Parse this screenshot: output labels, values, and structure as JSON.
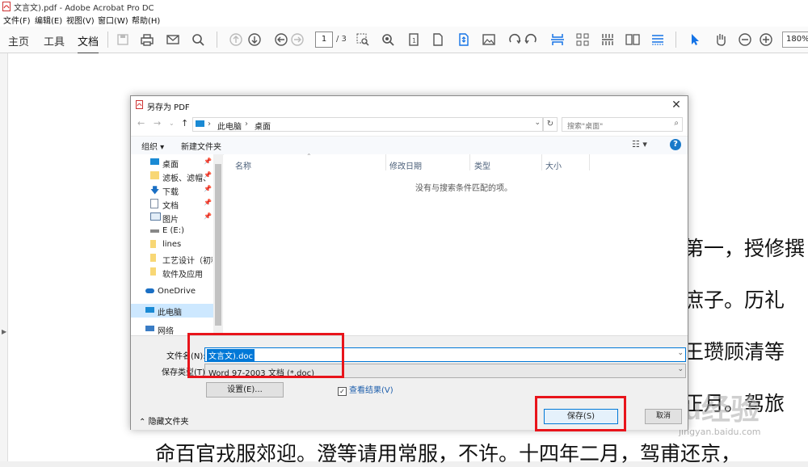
{
  "window": {
    "title": "文言文).pdf - Adobe Acrobat Pro DC"
  },
  "menu": [
    "文件(F)",
    "编辑(E)",
    "视图(V)",
    "窗口(W)",
    "帮助(H)"
  ],
  "toolbar": {
    "tabs": [
      "主页",
      "工具",
      "文档"
    ],
    "page_current": "1",
    "page_total": "/ 3",
    "zoom": "180%",
    "icons": [
      "save-icon",
      "print-icon",
      "email-icon",
      "search-icon",
      "prev-page-icon",
      "next-page-icon",
      "back-icon",
      "forward-icon",
      "marquee-zoom-icon",
      "zoom-icon",
      "single-page-icon",
      "page-icon",
      "fit-page-icon",
      "image-icon",
      "rotate-cw-icon",
      "rotate-ccw-icon",
      "split-icon",
      "grid-icon",
      "two-page-icon",
      "scroll-icon",
      "select-icon",
      "hand-icon",
      "zoom-out-icon",
      "zoom-in-icon"
    ]
  },
  "document": {
    "lines": [
      "第一，授修撰",
      "庶子。历礼",
      "王瓒顾清等",
      "正月。驾旅",
      "命百官戎服郊迎。澄等请用常服，不许。十四年二月，驾甫还京，"
    ]
  },
  "watermark": {
    "text": "Baidu经验",
    "sub": "jingyan.baidu.com"
  },
  "dialog": {
    "title": "另存为 PDF",
    "close": "✕",
    "address": {
      "crumbs": [
        "此电脑",
        "桌面"
      ]
    },
    "search_placeholder": "搜索\"桌面\"",
    "commands": {
      "organize": "组织 ▾",
      "new_folder": "新建文件夹"
    },
    "help": "?",
    "nav_items": [
      {
        "label": "桌面",
        "pinned": true
      },
      {
        "label": "滤板、滤帽、",
        "pinned": true
      },
      {
        "label": "下载",
        "pinned": true
      },
      {
        "label": "文档",
        "pinned": true
      },
      {
        "label": "图片",
        "pinned": true
      },
      {
        "label": "E (E:)",
        "pinned": false
      },
      {
        "label": "lines",
        "pinned": false
      },
      {
        "label": "工艺设计（初稿",
        "pinned": false
      },
      {
        "label": "软件及应用",
        "pinned": false
      },
      {
        "label": "OneDrive",
        "pinned": false
      },
      {
        "label": "此电脑",
        "pinned": false
      },
      {
        "label": "网络",
        "pinned": false
      }
    ],
    "columns": [
      "名称",
      "修改日期",
      "类型",
      "大小"
    ],
    "empty_message": "没有与搜索条件匹配的项。",
    "filename_label": "文件名(N):",
    "filename_value": "文言文).doc",
    "filetype_label": "保存类型(T):",
    "filetype_value": "Word 97-2003 文档 (*.doc)",
    "settings_button": "设置(E)...",
    "view_results": "查看结果(V)",
    "hide_folders": "隐藏文件夹",
    "save_button": "保存(S)",
    "cancel_button": "取消"
  },
  "colors": {
    "highlight": "#e8141b",
    "accent": "#0078d7"
  }
}
